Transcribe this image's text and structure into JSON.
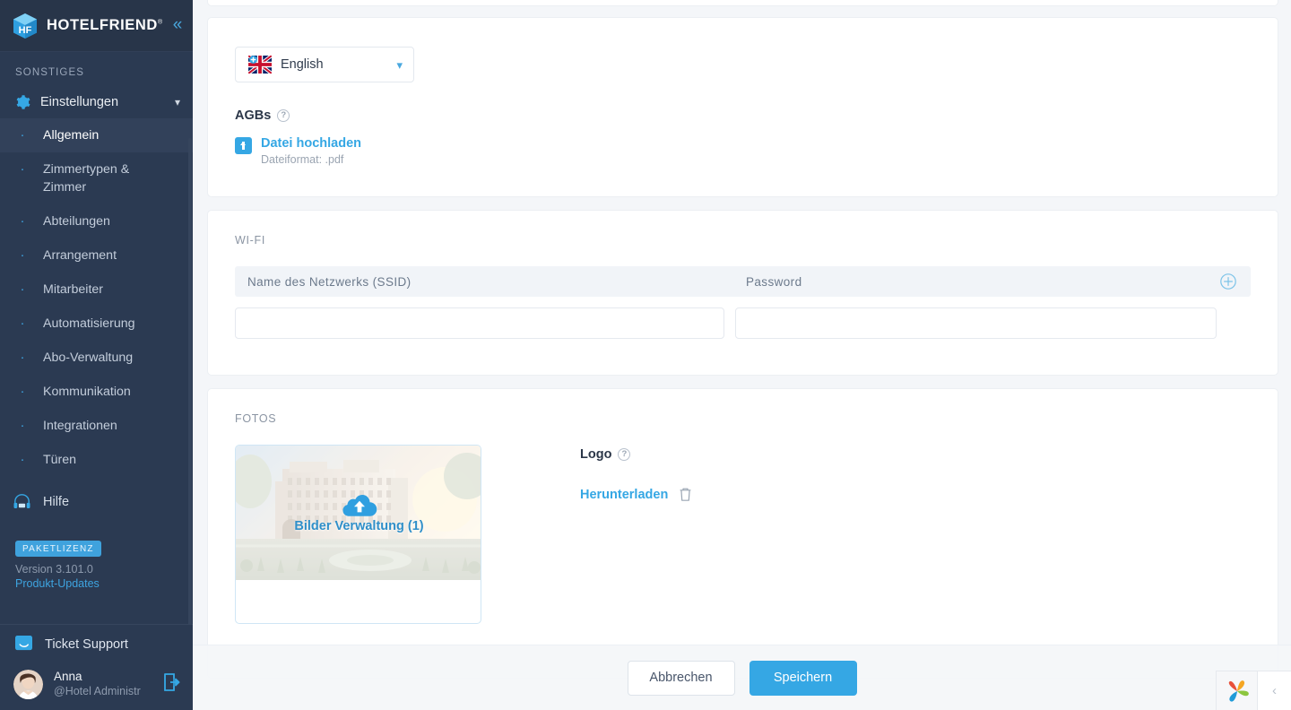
{
  "sidebar": {
    "brand": {
      "name": "HOTELFRIEND",
      "registered": "®",
      "collapse_icon": "chevrons-left-icon"
    },
    "section_title": "SONSTIGES",
    "group": {
      "label": "Einstellungen",
      "icon": "gear-icon",
      "chevron": "chevron-down-icon"
    },
    "items": [
      {
        "label": "Allgemein",
        "active": true
      },
      {
        "label": "Zimmertypen & Zimmer",
        "active": false
      },
      {
        "label": "Abteilungen",
        "active": false
      },
      {
        "label": "Arrangement",
        "active": false
      },
      {
        "label": "Mitarbeiter",
        "active": false
      },
      {
        "label": "Automatisierung",
        "active": false
      },
      {
        "label": "Abo-Verwaltung",
        "active": false
      },
      {
        "label": "Kommunikation",
        "active": false
      },
      {
        "label": "Integrationen",
        "active": false
      },
      {
        "label": "Türen",
        "active": false
      }
    ],
    "help": {
      "label": "Hilfe",
      "icon": "headset-icon"
    },
    "license": {
      "badge": "PAKETLIZENZ",
      "version": "Version 3.101.0",
      "updates_link": "Produkt-Updates"
    },
    "ticket_support": {
      "label": "Ticket Support",
      "icon": "chat-bubble-icon"
    },
    "user": {
      "name": "Anna",
      "role": "@Hotel Administr",
      "logout_icon": "logout-icon"
    }
  },
  "main": {
    "language": {
      "value": "English",
      "flag": "uk-flag-icon",
      "add_badge": "add-language-badge",
      "chevron": "chevron-down-icon"
    },
    "agb": {
      "title": "AGBs",
      "help_icon": "question-mark-icon",
      "upload_label": "Datei hochladen",
      "upload_icon": "upload-icon",
      "format_hint": "Dateiformat: .pdf"
    },
    "wifi": {
      "section_label": "WI-FI",
      "columns": [
        "Name des Netzwerks (SSID)",
        "Password"
      ],
      "add_icon": "plus-circle-icon",
      "rows": [
        {
          "ssid": "",
          "password": ""
        }
      ],
      "placeholders": {
        "ssid": "",
        "password": ""
      }
    },
    "fotos": {
      "section_label": "FOTOS",
      "photo": {
        "caption": "Bilder Verwaltung (1)",
        "icon": "cloud-upload-icon"
      },
      "logo": {
        "title": "Logo",
        "help_icon": "question-mark-icon",
        "download_label": "Herunterladen",
        "delete_icon": "trash-icon"
      }
    },
    "footer": {
      "cancel_label": "Abbrechen",
      "save_label": "Speichern"
    }
  },
  "chat_widget": {
    "logo_icon": "pinwheel-logo-icon",
    "collapse_icon": "chevron-left-icon"
  },
  "colors": {
    "sidebar_bg": "#2b3a52",
    "accent": "#35a7e4",
    "page_bg": "#f4f6f9",
    "text_dark": "#2b3648",
    "muted": "#8b95a3"
  }
}
